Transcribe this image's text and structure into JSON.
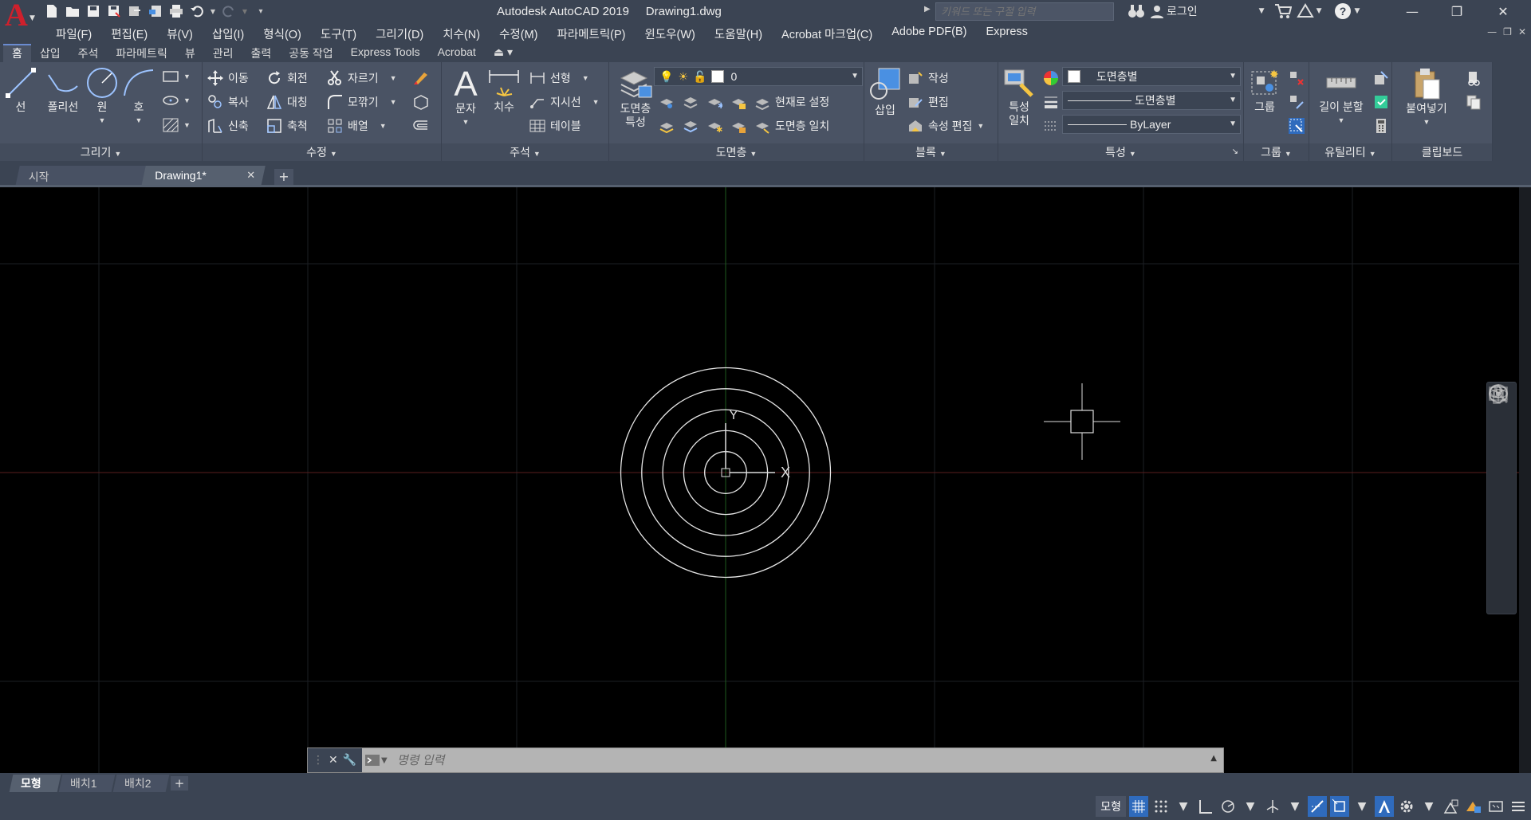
{
  "titlebar": {
    "app_title": "Autodesk AutoCAD 2019",
    "document": "Drawing1.dwg",
    "search_placeholder": "키워드 또는 구절 입력",
    "login": "로그인"
  },
  "menu": [
    "파일(F)",
    "편집(E)",
    "뷰(V)",
    "삽입(I)",
    "형식(O)",
    "도구(T)",
    "그리기(D)",
    "치수(N)",
    "수정(M)",
    "파라메트릭(P)",
    "윈도우(W)",
    "도움말(H)",
    "Acrobat 마크업(C)",
    "Adobe PDF(B)",
    "Express"
  ],
  "ribbon_tabs": [
    "홈",
    "삽입",
    "주석",
    "파라메트릭",
    "뷰",
    "관리",
    "출력",
    "공동 작업",
    "Express Tools",
    "Acrobat"
  ],
  "ribbon": {
    "draw": {
      "title": "그리기",
      "line": "선",
      "polyline": "폴리선",
      "circle": "원",
      "arc": "호"
    },
    "modify": {
      "title": "수정",
      "move": "이동",
      "rotate": "회전",
      "trim": "자르기",
      "copy": "복사",
      "mirror": "대칭",
      "fillet": "모깎기",
      "stretch": "신축",
      "scale": "축척",
      "array": "배열"
    },
    "annotation": {
      "title": "주석",
      "text": "문자",
      "dimension": "치수",
      "linear": "선형",
      "leader": "지시선",
      "table": "테이블"
    },
    "layers": {
      "title": "도면층",
      "properties_1": "도면층",
      "properties_2": "특성",
      "current_layer": "0",
      "set_current": "현재로 설정",
      "match_layer": "도면층 일치"
    },
    "block": {
      "title": "블록",
      "insert": "삽입",
      "create": "작성",
      "edit": "편집",
      "edit_attributes": "속성 편집"
    },
    "properties": {
      "title": "특성",
      "match_1": "특성",
      "match_2": "일치",
      "color": "도면층별",
      "linetype": "도면층별",
      "lineweight": "ByLayer"
    },
    "groups": {
      "title": "그룹",
      "group": "그룹"
    },
    "utilities": {
      "title": "유틸리티",
      "measure": "길이 분할"
    },
    "clipboard": {
      "title": "클립보드",
      "paste": "붙여넣기"
    }
  },
  "file_tabs": {
    "start": "시작",
    "drawing": "Drawing1*"
  },
  "drawing": {
    "concentric_circles": 5,
    "ucs_x_label": "X",
    "ucs_y_label": "Y"
  },
  "command_line": {
    "placeholder": "명령 입력"
  },
  "layout_tabs": [
    "모형",
    "배치1",
    "배치2"
  ],
  "status": {
    "model": "모형"
  },
  "colors": {
    "chrome": "#3b4453",
    "ribbon": "#4a5364",
    "canvas": "#000000",
    "x_axis": "#5a1e1e",
    "y_axis": "#1e5a1e",
    "accent": "#2f6bbd",
    "logo": "#d0202c"
  }
}
